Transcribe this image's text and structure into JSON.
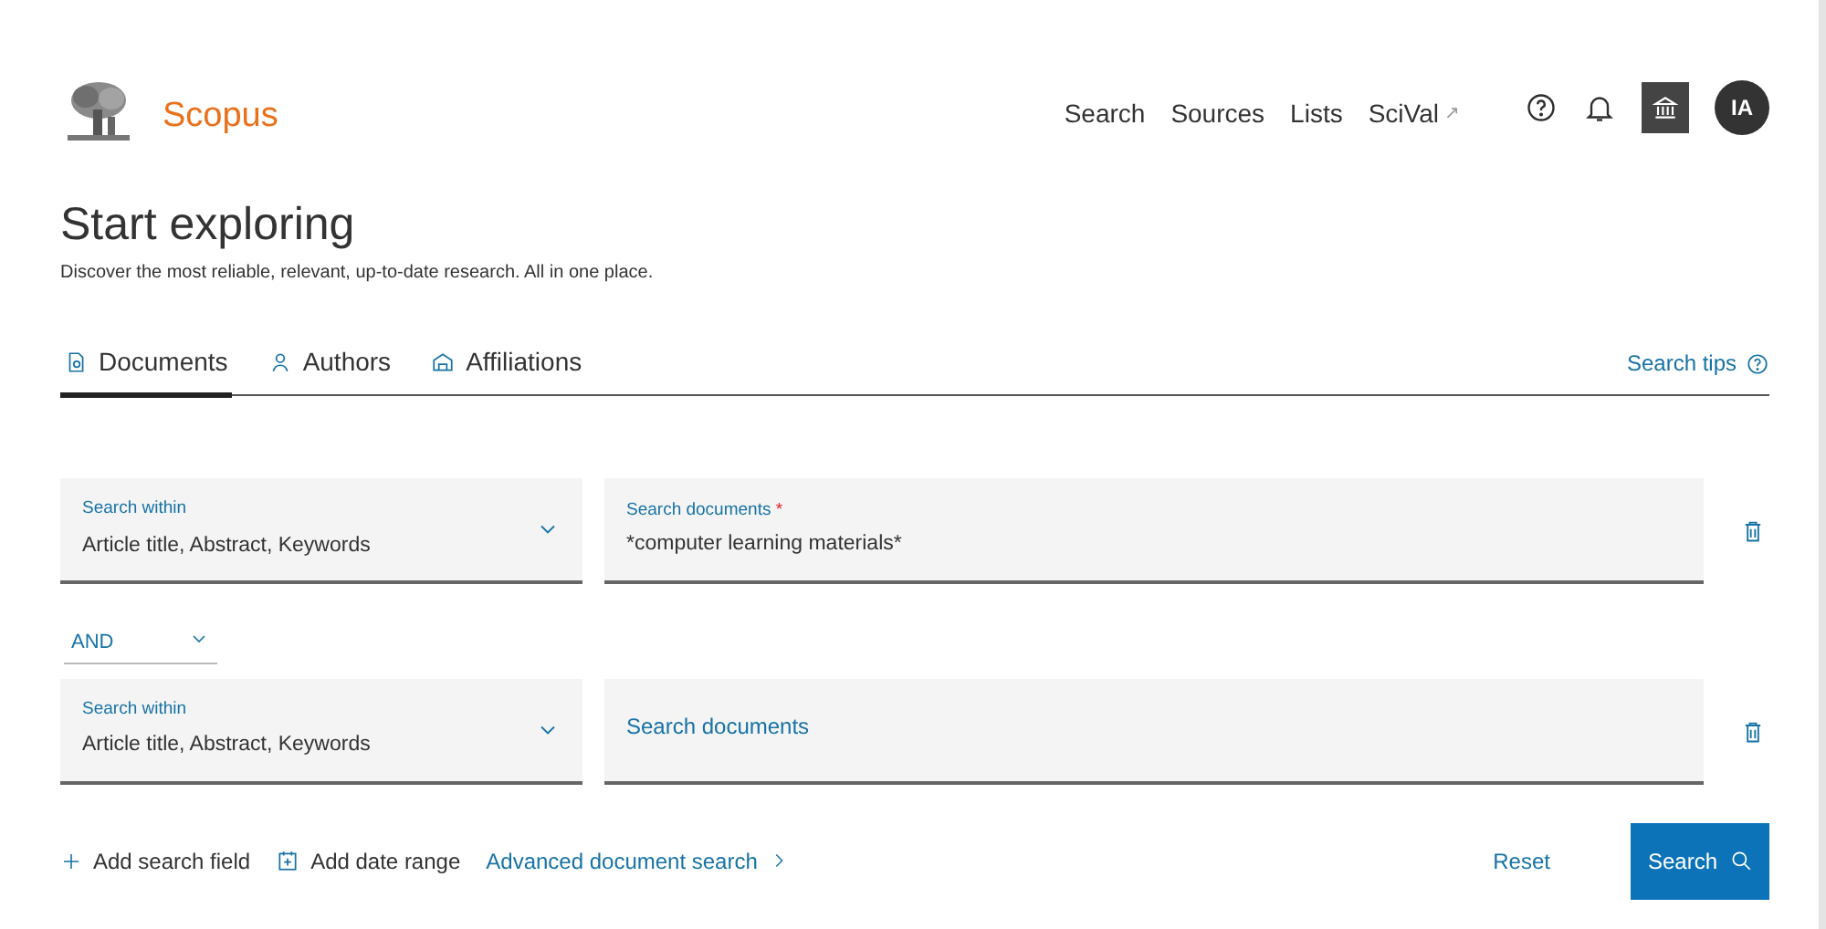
{
  "header": {
    "brand": "Scopus",
    "nav": [
      {
        "label": "Search"
      },
      {
        "label": "Sources"
      },
      {
        "label": "Lists"
      },
      {
        "label": "SciVal",
        "external_mark": "↗"
      }
    ],
    "avatar": "IA"
  },
  "intro": {
    "title": "Start exploring",
    "subtitle": "Discover the most reliable, relevant, up-to-date research. All in one place."
  },
  "tabs": [
    {
      "label": "Documents",
      "kind": "documents",
      "selected": true
    },
    {
      "label": "Authors",
      "kind": "authors",
      "selected": false
    },
    {
      "label": "Affiliations",
      "kind": "affiliations",
      "selected": false
    }
  ],
  "search_tips": "Search tips",
  "search_rows": [
    {
      "within_label": "Search within",
      "within_value": "Article title, Abstract, Keywords",
      "field_label": "Search documents",
      "required_mark": "*",
      "value": "*computer learning materials*"
    },
    {
      "connector": "AND",
      "within_label": "Search within",
      "within_value": "Article title, Abstract, Keywords",
      "placeholder": "Search documents"
    }
  ],
  "actions": [
    {
      "label": "Add search field",
      "kind": "plus"
    },
    {
      "label": "Add date range",
      "kind": "calendar"
    },
    {
      "label": "Advanced document search",
      "kind": "chevron"
    }
  ],
  "buttons": {
    "reset": "Reset",
    "search": "Search"
  }
}
